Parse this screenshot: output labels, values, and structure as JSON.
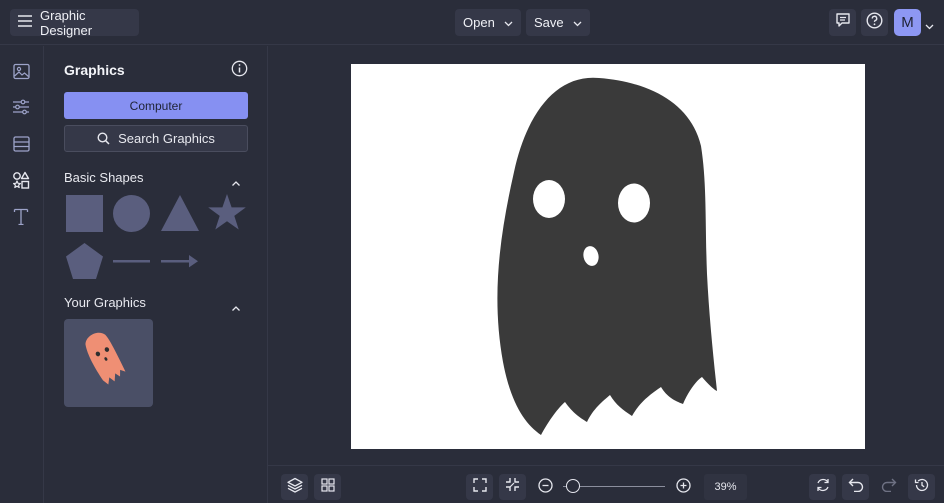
{
  "app": {
    "title": "Graphic Designer"
  },
  "toolbar": {
    "open_label": "Open",
    "save_label": "Save",
    "avatar_initial": "M"
  },
  "rail": {
    "items": [
      "image-icon",
      "sliders-icon",
      "layout-icon",
      "shapes-icon",
      "text-icon"
    ]
  },
  "panel": {
    "title": "Graphics",
    "computer_label": "Computer",
    "search_label": "Search Graphics",
    "sections": {
      "basic_shapes": {
        "title": "Basic Shapes",
        "items": [
          "square",
          "circle",
          "triangle",
          "star",
          "pentagon",
          "line",
          "arrow"
        ]
      },
      "your_graphics": {
        "title": "Your Graphics"
      }
    }
  },
  "zoom": {
    "value": "39",
    "unit": "%"
  },
  "colors": {
    "accent": "#8690f2",
    "shape_fill": "#5a5e7e",
    "ghost_canvas": "#3a3a3a",
    "ghost_thumb": "#ef8f74"
  }
}
